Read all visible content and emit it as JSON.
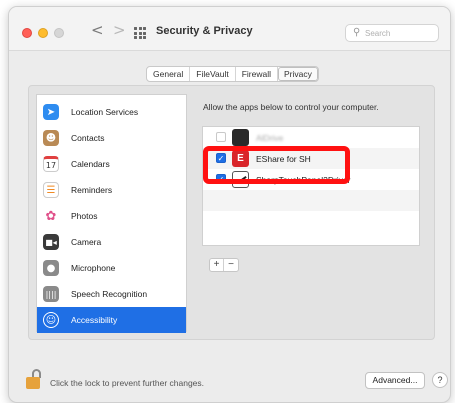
{
  "window": {
    "title": "Security & Privacy",
    "nav_back_glyph": "<",
    "nav_forward_glyph": ">"
  },
  "search": {
    "placeholder": "Search",
    "value": ""
  },
  "tabs": [
    {
      "label": "General",
      "active": false
    },
    {
      "label": "FileVault",
      "active": false
    },
    {
      "label": "Firewall",
      "active": false
    },
    {
      "label": "Privacy",
      "active": true
    }
  ],
  "sidebar": {
    "items": [
      {
        "label": "Location Services",
        "icon": "location-arrow-icon",
        "icon_color": "#2e8cf0",
        "glyph": "➤"
      },
      {
        "label": "Contacts",
        "icon": "contacts-book-icon",
        "icon_color": "#b98a55",
        "glyph": "👤"
      },
      {
        "label": "Calendars",
        "icon": "calendar-icon",
        "icon_color": "#ffffff",
        "glyph": "17"
      },
      {
        "label": "Reminders",
        "icon": "reminders-list-icon",
        "icon_color": "#ffffff",
        "glyph": "☰"
      },
      {
        "label": "Photos",
        "icon": "photos-flower-icon",
        "icon_color": "#ffffff",
        "glyph": "✿"
      },
      {
        "label": "Camera",
        "icon": "camera-icon",
        "icon_color": "#3a3a3a",
        "glyph": "■"
      },
      {
        "label": "Microphone",
        "icon": "microphone-icon",
        "icon_color": "#8a8a8a",
        "glyph": "🎙"
      },
      {
        "label": "Speech Recognition",
        "icon": "speech-waveform-icon",
        "icon_color": "#8a8a8a",
        "glyph": "|||"
      },
      {
        "label": "Accessibility",
        "icon": "accessibility-icon",
        "icon_color": "#1f6fe5",
        "glyph": "♿",
        "selected": true
      }
    ]
  },
  "privacy_panel": {
    "description": "Allow the apps below to control your computer.",
    "apps": [
      {
        "name": "AlDrive",
        "checked": false,
        "blurred": true
      },
      {
        "name": "EShare for SH",
        "checked": true,
        "icon_label": "E"
      },
      {
        "name": "SharpTouchPanel2Driver",
        "checked": true
      }
    ],
    "add_label": "+",
    "remove_label": "−"
  },
  "footer": {
    "lock_text": "Click the lock to prevent further changes.",
    "advanced_label": "Advanced...",
    "help_label": "?"
  },
  "colors": {
    "accent": "#1f6fe5",
    "highlight": "#ff1111",
    "eshare_red": "#d9252a"
  }
}
